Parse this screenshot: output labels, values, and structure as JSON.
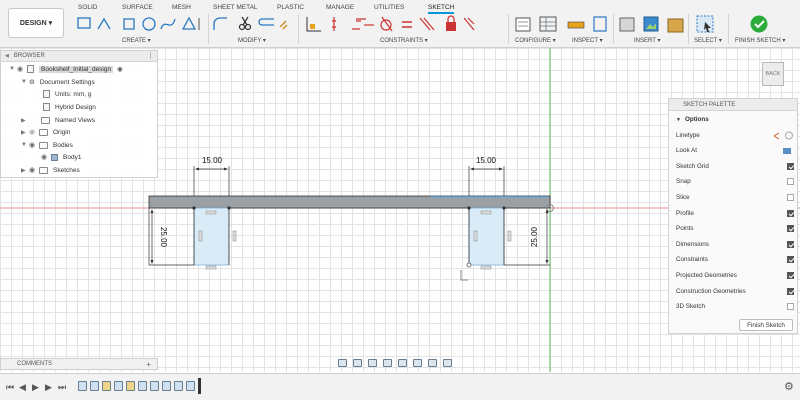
{
  "toolbar": {
    "design_label": "DESIGN",
    "tabs": [
      "SOLID",
      "SURFACE",
      "MESH",
      "SHEET METAL",
      "PLASTIC",
      "MANAGE",
      "UTILITIES",
      "SKETCH"
    ],
    "active_tab": "SKETCH",
    "groups": [
      "CREATE",
      "MODIFY",
      "CONSTRAINTS",
      "CONFIGURE",
      "INSPECT",
      "INSERT",
      "SELECT",
      "FINISH SKETCH"
    ],
    "accent_color": "#0696d7",
    "finish_color": "#2dab3a"
  },
  "browser": {
    "title": "BROWSER",
    "items": [
      {
        "label": "Bookshelf_Initial_design",
        "icon": "document-icon"
      },
      {
        "label": "Document Settings",
        "icon": "gear-icon"
      },
      {
        "label": "Units: mm, g",
        "icon": "document-icon"
      },
      {
        "label": "Hybrid Design",
        "icon": "document-icon"
      },
      {
        "label": "Named Views",
        "icon": "folder-icon"
      },
      {
        "label": "Origin",
        "icon": "folder-icon"
      },
      {
        "label": "Bodies",
        "icon": "folder-icon"
      },
      {
        "label": "Body1",
        "icon": "body-cube-icon"
      },
      {
        "label": "Sketches",
        "icon": "folder-icon"
      }
    ]
  },
  "sketch": {
    "dimensions": {
      "left_width": "15.00",
      "right_width": "15.00",
      "left_height": "25.00",
      "right_height": "25.00"
    },
    "line_color": "#333333",
    "body_color": "#9aa0a4",
    "leg_fill": "#d9ebf7",
    "axis_red": "#d9534f",
    "axis_green": "#3cb043"
  },
  "viewcube": {
    "label": "BACK"
  },
  "palette": {
    "title": "SKETCH PALETTE",
    "section": "Options",
    "options": [
      {
        "label": "Linetype",
        "type": "icon"
      },
      {
        "label": "Look At",
        "type": "icon"
      },
      {
        "label": "Sketch Grid",
        "checked": true
      },
      {
        "label": "Snap",
        "checked": false
      },
      {
        "label": "Slice",
        "checked": false
      },
      {
        "label": "Profile",
        "checked": true
      },
      {
        "label": "Points",
        "checked": true
      },
      {
        "label": "Dimensions",
        "checked": true
      },
      {
        "label": "Constraints",
        "checked": true
      },
      {
        "label": "Projected Geometries",
        "checked": true
      },
      {
        "label": "Construction Geometries",
        "checked": true
      },
      {
        "label": "3D Sketch",
        "checked": false
      }
    ],
    "finish_button": "Finish Sketch"
  },
  "comments": {
    "label": "COMMENTS"
  }
}
